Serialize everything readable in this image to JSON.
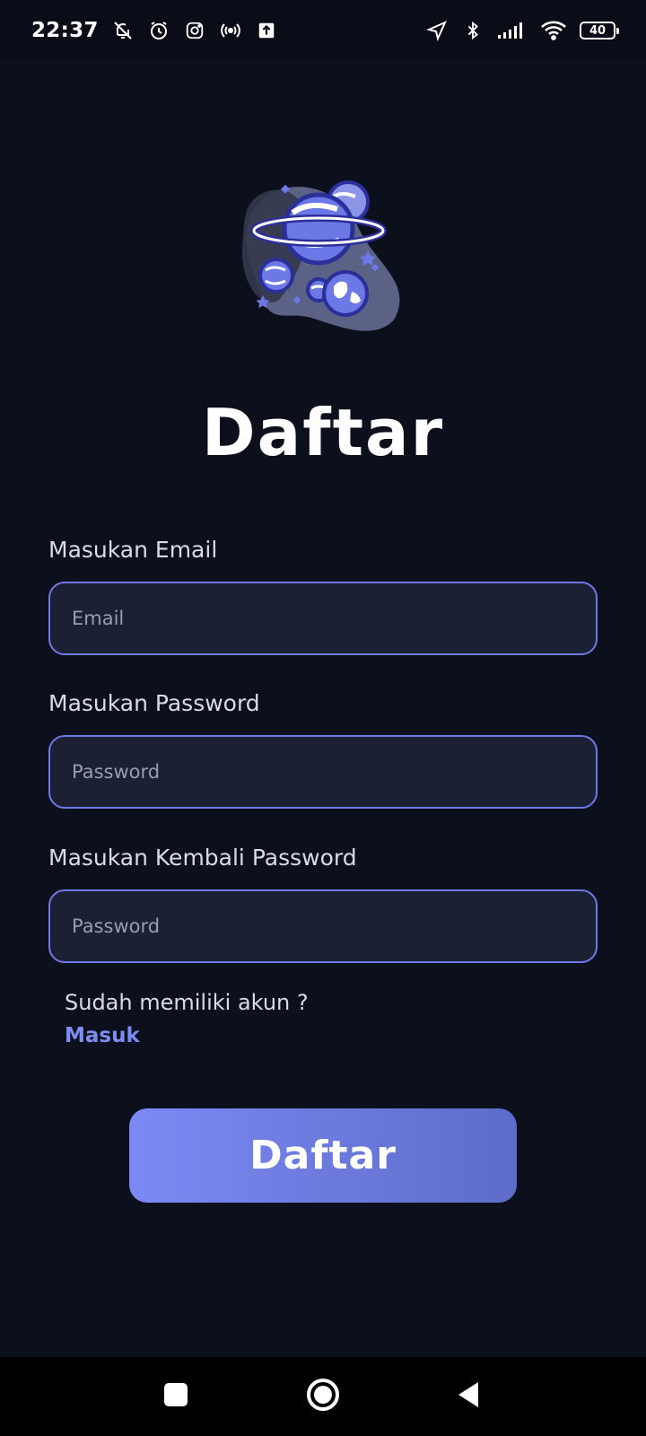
{
  "status_bar": {
    "time": "22:37",
    "icons_left": [
      "bell-off-icon",
      "alarm-icon",
      "instagram-icon",
      "hotspot-icon",
      "upload-icon"
    ],
    "icons_right": [
      "location-icon",
      "bluetooth-icon",
      "signal-icon",
      "wifi-icon"
    ],
    "battery": "40"
  },
  "page": {
    "title": "Daftar",
    "email": {
      "label": "Masukan Email",
      "placeholder": "Email",
      "value": ""
    },
    "password": {
      "label": "Masukan Password",
      "placeholder": "Password",
      "value": ""
    },
    "confirm_password": {
      "label": "Masukan Kembali Password",
      "placeholder": "Password",
      "value": ""
    },
    "account_prompt": "Sudah memiliki akun ?",
    "login_link": "Masuk",
    "submit_label": "Daftar"
  },
  "nav_bar": {
    "icons": [
      "recents-icon",
      "home-icon",
      "back-icon"
    ]
  },
  "colors": {
    "background": "#0c0f1c",
    "field_bg": "#1c2035",
    "field_border": "#6f79e6",
    "accent": "#7f8cf2",
    "button_gradient_start": "#7c89f4",
    "button_gradient_end": "#5d6cc8"
  }
}
